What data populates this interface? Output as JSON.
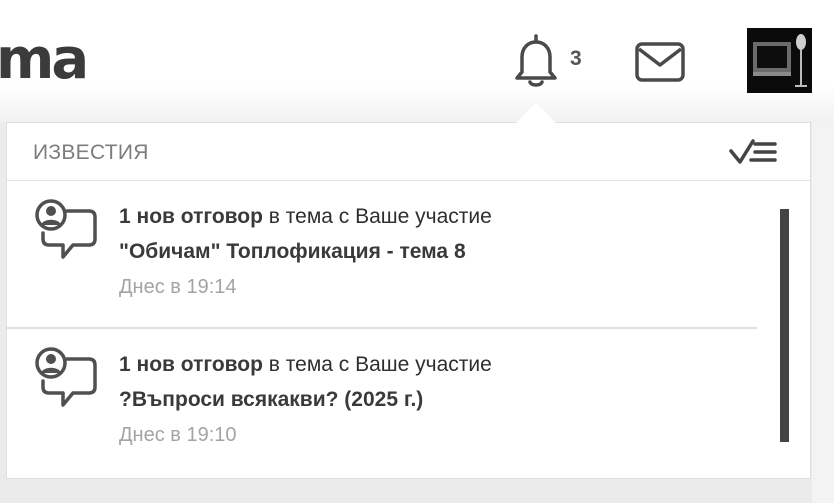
{
  "header": {
    "logo_text": "ma",
    "notifications_count": "3",
    "bell_icon": "bell-icon",
    "mail_icon": "envelope-icon",
    "avatar_icon": "user-avatar-microphone"
  },
  "panel": {
    "title": "ИЗВЕСТИЯ",
    "mark_all_icon": "mark-all-read-icon",
    "items": [
      {
        "action_bold": "1 нов отговор",
        "action_rest": " в тема с Ваше участие",
        "topic": "\"Обичам\" Топлофикация - тема 8",
        "time": "Днес в 19:14",
        "icon": "user-reply-bubble-icon"
      },
      {
        "action_bold": "1 нов отговор",
        "action_rest": " в тема с Ваше участие",
        "topic": "?Въпроси всякакви? (2025 г.)",
        "time": "Днес в 19:10",
        "icon": "user-reply-bubble-icon"
      }
    ]
  },
  "colors": {
    "text_dark": "#3a3a3a",
    "text_muted": "#a4a4a4",
    "scrollbar": "#444444"
  }
}
